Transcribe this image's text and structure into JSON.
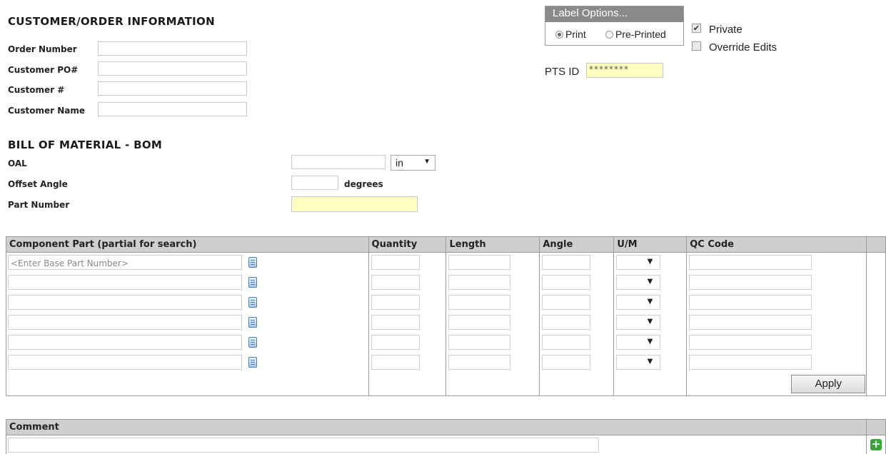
{
  "customer_section": {
    "title": "CUSTOMER/ORDER INFORMATION",
    "fields": [
      {
        "label": "Order Number",
        "value": ""
      },
      {
        "label": "Customer PO#",
        "value": ""
      },
      {
        "label": "Customer #",
        "value": ""
      },
      {
        "label": "Customer Name",
        "value": ""
      }
    ]
  },
  "label_options": {
    "title": "Label Options...",
    "print_label": "Print",
    "preprinted_label": "Pre-Printed",
    "selected": "Print"
  },
  "private_label": "Private",
  "private_checked": true,
  "override_label": "Override Edits",
  "override_checked": false,
  "pts": {
    "label": "PTS ID",
    "value": "********"
  },
  "bom": {
    "title": "BILL OF MATERIAL - BOM",
    "oal_label": "OAL",
    "oal_value": "",
    "oal_unit": "in",
    "offset_label": "Offset Angle",
    "offset_value": "",
    "offset_unit": "degrees",
    "part_label": "Part Number",
    "part_value": ""
  },
  "grid": {
    "headers": [
      "Component Part (partial for search)",
      "Quantity",
      "Length",
      "Angle",
      "U/M",
      "QC Code"
    ],
    "first_placeholder": "<Enter Base Part Number>",
    "rows": 6,
    "apply_label": "Apply"
  },
  "comment": {
    "header": "Comment",
    "value": ""
  },
  "icons": {
    "search": "document-search-icon",
    "add": "plus-icon"
  }
}
